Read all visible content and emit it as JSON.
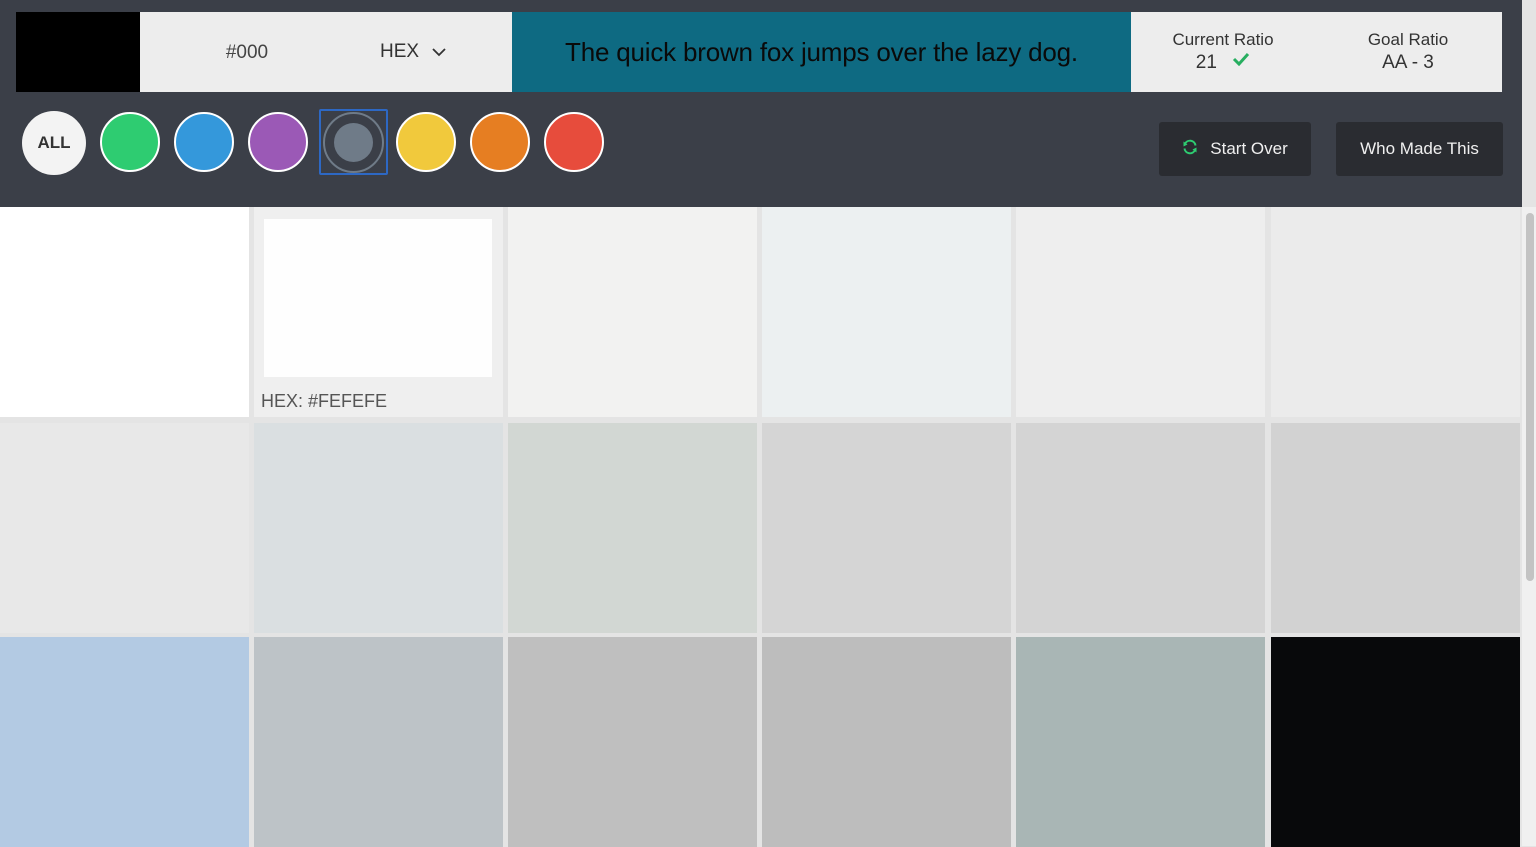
{
  "color_input": {
    "preview_color": "#000000",
    "value": "#000",
    "format": "HEX"
  },
  "sample": {
    "text": "The quick brown fox jumps over the lazy dog.",
    "background": "#0e6a82",
    "text_color": "#0a0a0a"
  },
  "ratio": {
    "current_label": "Current Ratio",
    "current_value": "21",
    "goal_label": "Goal Ratio",
    "goal_value": "AA - 3",
    "pass_color": "#27ae60"
  },
  "filters": {
    "all_label": "ALL",
    "colors": [
      {
        "name": "green",
        "hex": "#2ecc71"
      },
      {
        "name": "blue",
        "hex": "#3498db"
      },
      {
        "name": "purple",
        "hex": "#9b59b6"
      },
      {
        "name": "grey",
        "hex": "#6f7b88",
        "selected": true
      },
      {
        "name": "yellow",
        "hex": "#f1c93c"
      },
      {
        "name": "orange",
        "hex": "#e67e22"
      },
      {
        "name": "red",
        "hex": "#e74c3c"
      }
    ]
  },
  "actions": {
    "start_over_label": "Start Over",
    "who_made_label": "Who Made This"
  },
  "grid": {
    "selected_hex_label": "HEX: #FEFEFE",
    "swatches": [
      "#ffffff",
      "#fefefe",
      "#f2f2f1",
      "#ecf0f1",
      "#eeeeee",
      "#ebebeb",
      "#e8e8e8",
      "#dadfe1",
      "#d2d7d3",
      "#d5d5d5",
      "#d4d4d4",
      "#d2d2d2",
      "#b3cae3",
      "#bdc3c7",
      "#bfbfbf",
      "#bdbdbd",
      "#a9b6b5",
      "#08090b"
    ]
  }
}
